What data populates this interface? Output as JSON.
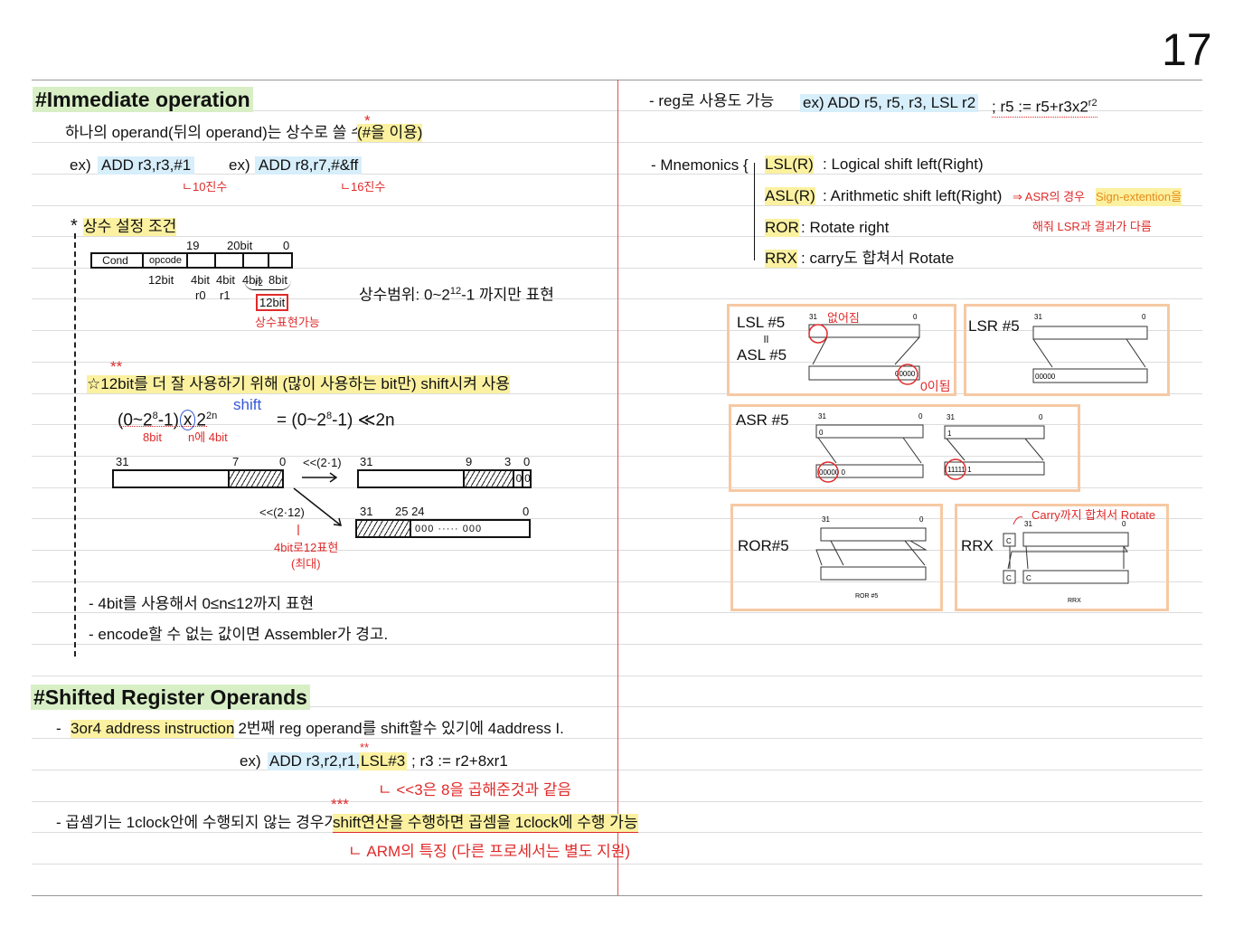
{
  "page_number": "17",
  "immediate": {
    "title": "#Immediate operation",
    "line1": "하나의 operand(뒤의 operand)는 상수로 쓸 수 있음",
    "line1_note": "(#을 이용)",
    "star": "*",
    "ex_label": "ex)",
    "ex1": "ADD r3,r3,#1",
    "ex1_note": "ㄴ10진수",
    "ex2": "ADD r8,r7,#&ff",
    "ex2_note": "ㄴ16진수",
    "condition_title": "상수 설정 조건",
    "condition_star": "*",
    "format": {
      "cells": [
        "Cond",
        "opcode"
      ],
      "top_labels": [
        "19",
        "20bit",
        "0"
      ],
      "bottom_labels": [
        "12bit",
        "4bit",
        "4bit",
        "4bit",
        "8bit"
      ],
      "regs": [
        "r0",
        "r1",
        "r2"
      ],
      "boxed": "12bit",
      "boxed_note": "상수표현가능"
    },
    "range_prefix": "상수범위: 0~2",
    "range_sup": "12",
    "range_suffix": "-1 까지만 표현",
    "tip_stars": "**",
    "tip": "☆12bit를 더 잘 사용하기 위해 (많이 사용하는 bit만) shift시켜 사용",
    "formula_left": "(0~2",
    "formula_sup8": "8",
    "formula_mid": "-1)",
    "formula_x": "x",
    "formula_2": "2",
    "formula_sup2n": "2n",
    "formula_shift": "shift",
    "formula_right": "= (0~2",
    "formula_right2": "-1) ≪2n",
    "note_8bit": "8bit",
    "note_n4bit": "n에 4bit",
    "bar1_labels": [
      "31",
      "7",
      "0"
    ],
    "shift1": "<<(2·1)",
    "bar2_labels": [
      "31",
      "9",
      "3",
      "0"
    ],
    "bar2_zeros": [
      "0",
      "0"
    ],
    "shift2": "<<(2·12)",
    "shift2_note1": "4bit로12표현",
    "shift2_note2": "(최대)",
    "bar3_labels": [
      "31",
      "25 24",
      "0"
    ],
    "bar3_fill": "000  ·····  000",
    "bullet1": "- 4bit를 사용해서 0≤n≤12까지 표현",
    "bullet2": "- encode할 수 없는 값이면 Assembler가 경고."
  },
  "shifted": {
    "title": "#Shifted Register Operands",
    "dash": "-",
    "hl1": "3or4 address instruction",
    "line1": ": 2번째 reg operand를 shift할수 있기에 4address I.",
    "ex_label": "ex)",
    "ex": "ADD r3,r2,r1,",
    "ex_lsl": "LSL#3",
    "ex_comment": "; r3 := r2+8xr1",
    "ex_stars": "**",
    "ex_note": "ㄴ <<3은 8을 곱해준것과 같음",
    "line2": "- 곱셈기는 1clock안에 수행되지 않는 경우가 많음 →",
    "line2_hl": "shift연산을 수행하면 곱셈을 1clock에 수행 가능",
    "line2_stars": "***",
    "line2_note": "ㄴ ARM의 특징 (다른 프로세서는 별도 지원)"
  },
  "right": {
    "reg_line": "- reg로 사용도 가능",
    "reg_ex": "ex) ADD r5, r5, r3, LSL r2",
    "reg_comment": "; r5 := r5+r3x2",
    "reg_sup": "r2",
    "mnemonics_label": "- Mnemonics {",
    "mnemonics": [
      {
        "code": "LSL(R)",
        "desc": ": Logical shift left(Right)"
      },
      {
        "code": "ASL(R)",
        "desc": ": Arithmetic shift left(Right)"
      },
      {
        "code": "ROR",
        "desc": ": Rotate right"
      },
      {
        "code": "RRX",
        "desc": ": carry도 합쳐서 Rotate"
      }
    ],
    "asr_note1": "⇒ ASR의 경우",
    "asr_note_hl": "Sign-extention을",
    "asr_note2": "해줘 LSR과 결과가 다름",
    "diagrams": {
      "lsl_title1": "LSL #5",
      "lsl_eq": "॥",
      "lsl_title2": "ASL #5",
      "lsl_lost": "없어짐",
      "lsl_zero": "0이됨",
      "lsr_title": "LSR #5",
      "asr_title": "ASR #5",
      "ror_title": "ROR#5",
      "ror_caption": "ROR #5",
      "rrx_title": "RRX",
      "rrx_note": "Carry까지 합쳐서 Rotate",
      "rrx_caption": "RRX",
      "bit31": "31",
      "bit0": "0",
      "zeros": "00000",
      "zeros_asr": "00000 0",
      "ones_asr": "11111 1",
      "asr_top0": "0",
      "asr_top1": "1",
      "carry": "C"
    }
  },
  "colors": {
    "red": "#e02a2a",
    "blue": "#3557d6",
    "green_hl": "#d8efc6",
    "blue_hl": "#d7eefb",
    "yellow_hl": "#fbf1a0",
    "orange_box": "#f6c9a3"
  }
}
